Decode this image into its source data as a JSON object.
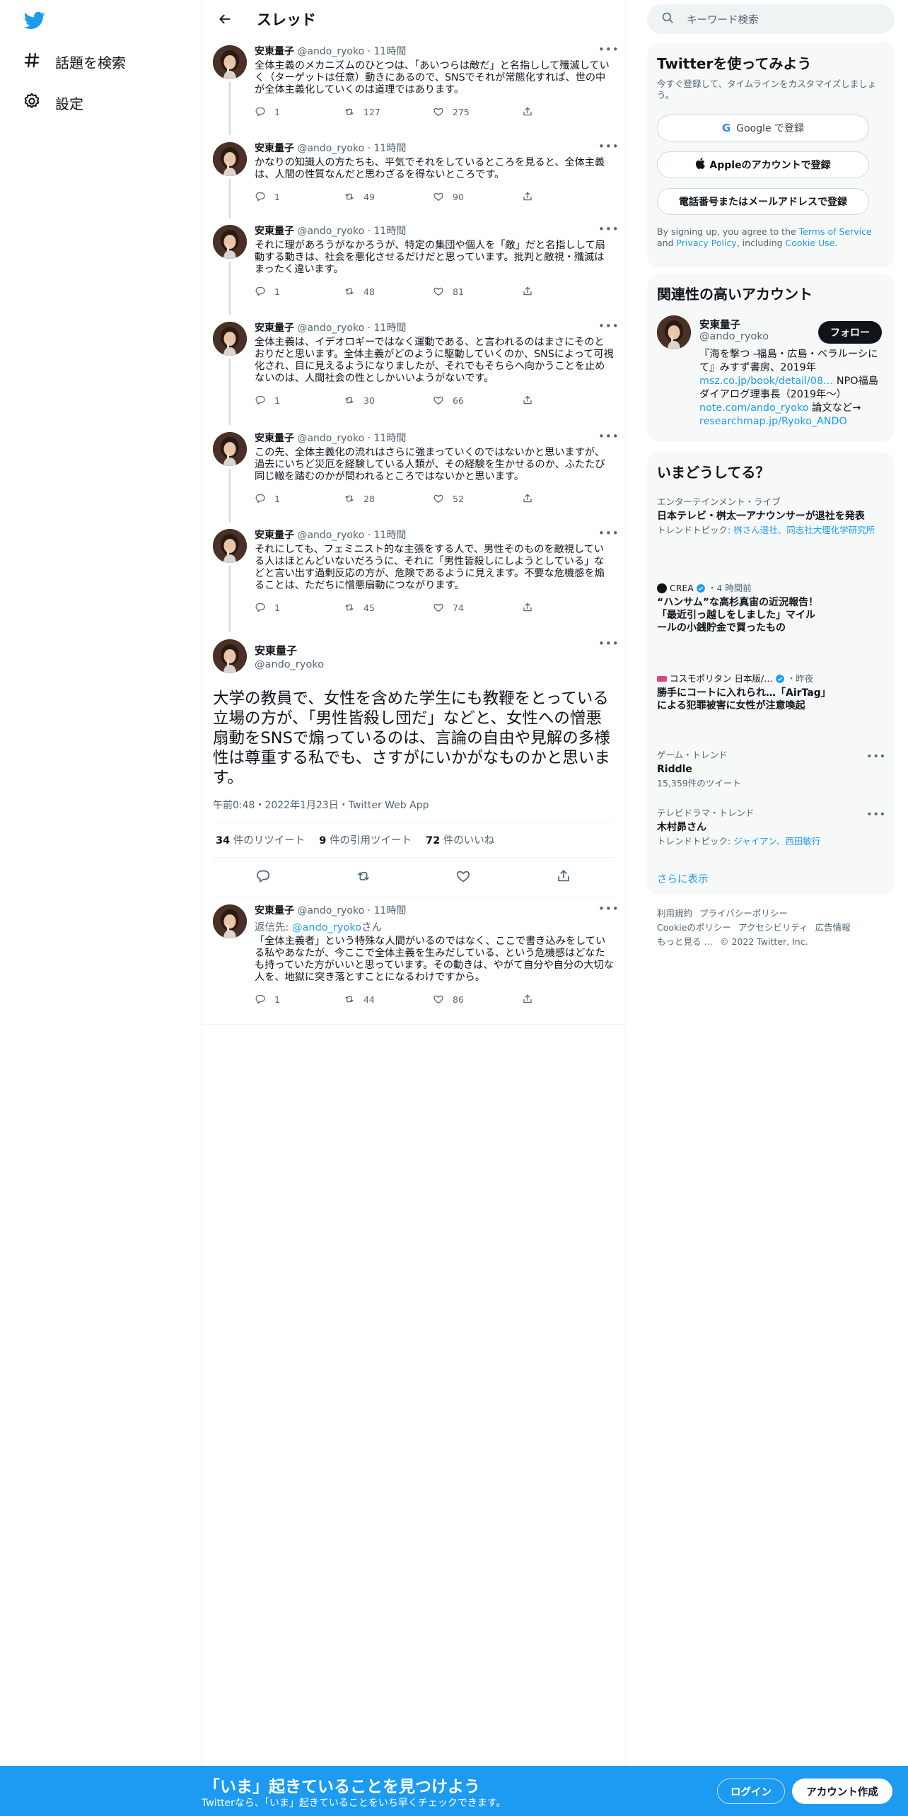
{
  "nav": {
    "explore_label": "話題を検索",
    "settings_label": "設定"
  },
  "header": {
    "title": "スレッド"
  },
  "thread_tweets": [
    {
      "name": "安東量子",
      "handle": "@ando_ryoko",
      "time": "11時間",
      "text": "全体主義のメカニズムのひとつは、「あいつらは敵だ」と名指しして殲滅していく（ターゲットは任意）動きにあるので、SNSでそれが常態化すれば、世の中が全体主義化していくのは道理ではあります。",
      "replies": "1",
      "retweets": "127",
      "likes": "275"
    },
    {
      "name": "安東量子",
      "handle": "@ando_ryoko",
      "time": "11時間",
      "text": "かなりの知識人の方たちも、平気でそれをしているところを見ると、全体主義は、人間の性質なんだと思わざるを得ないところです。",
      "replies": "1",
      "retweets": "49",
      "likes": "90"
    },
    {
      "name": "安東量子",
      "handle": "@ando_ryoko",
      "time": "11時間",
      "text": "それに理があろうがなかろうが、特定の集団や個人を「敵」だと名指しして扇動する動きは、社会を悪化させるだけだと思っています。批判と敵視・殲滅はまったく違います。",
      "replies": "1",
      "retweets": "48",
      "likes": "81"
    },
    {
      "name": "安東量子",
      "handle": "@ando_ryoko",
      "time": "11時間",
      "text": "全体主義は、イデオロギーではなく運動である、と言われるのはまさにそのとおりだと思います。全体主義がどのように駆動していくのか、SNSによって可視化され、目に見えるようになりましたが、それでもそちらへ向かうことを止めないのは、人間社会の性としかいいようがないです。",
      "replies": "1",
      "retweets": "30",
      "likes": "66"
    },
    {
      "name": "安東量子",
      "handle": "@ando_ryoko",
      "time": "11時間",
      "text": "この先、全体主義化の流れはさらに強まっていくのではないかと思いますが、過去にいちど災厄を経験している人類が、その経験を生かせるのか、ふたたび同じ轍を踏むのかが問われるところではないかと思います。",
      "replies": "1",
      "retweets": "28",
      "likes": "52"
    },
    {
      "name": "安東量子",
      "handle": "@ando_ryoko",
      "time": "11時間",
      "text": "それにしても、フェミニスト的な主張をする人で、男性そのものを敵視している人はほとんどいないだろうに、それに「男性皆殺しにしようとしている」などと言い出す過剰反応の方が、危険であるように見えます。不要な危機感を煽ることは、ただちに憎悪扇動につながります。",
      "replies": "1",
      "retweets": "45",
      "likes": "74"
    }
  ],
  "main_tweet": {
    "name": "安東量子",
    "handle": "@ando_ryoko",
    "text": "大学の教員で、女性を含めた学生にも教鞭をとっている立場の方が、「男性皆殺し団だ」などと、女性への憎悪扇動をSNSで煽っているのは、言論の自由や見解の多様性は尊重する私でも、さすがにいかがなものかと思います。",
    "timestamp": "午前0:48・2022年1月23日・Twitter Web App",
    "retweet_count": "34",
    "retweet_label": "件のリツイート",
    "quote_count": "9",
    "quote_label": "件の引用ツイート",
    "like_count": "72",
    "like_label": "件のいいね"
  },
  "reply_tweet": {
    "name": "安東量子",
    "handle": "@ando_ryoko",
    "time": "11時間",
    "reply_prefix": "返信先: ",
    "reply_target": "@ando_ryoko",
    "reply_suffix": "さん",
    "text": "「全体主義者」という特殊な人間がいるのではなく、ここで書き込みをしている私やあなたが、今ここで全体主義を生みだしている、という危機感はどなたも持っていた方がいいと思っています。その動きは、やがて自分や自分の大切な人を、地獄に突き落とすことになるわけですから。",
    "replies": "1",
    "retweets": "44",
    "likes": "86"
  },
  "search": {
    "placeholder": "キーワード検索"
  },
  "signup": {
    "title": "Twitterを使ってみよう",
    "subtitle": "今すぐ登録して、タイムラインをカスタマイズしましょう。",
    "google_label": "Google で登録",
    "apple_label": "Appleのアカウントで登録",
    "phone_label": "電話番号またはメールアドレスで登録",
    "tos_prefix": "By signing up, you agree to the ",
    "tos_terms": "Terms of Service",
    "tos_and": " and ",
    "tos_privacy": "Privacy Policy",
    "tos_including": ", including ",
    "tos_cookie": "Cookie Use",
    "tos_end": "."
  },
  "related": {
    "title": "関連性の高いアカウント",
    "name": "安東量子",
    "handle": "@ando_ryoko",
    "follow_label": "フォロー",
    "bio_1": "『海を撃つ -福島・広島・ベラルーシにて』みすず書房、2019年",
    "bio_link_1": "msz.co.jp/book/detail/08…",
    "bio_2": " NPO福島ダイアログ理事長（2019年〜）",
    "bio_link_2": "note.com/ando_ryoko",
    "bio_3": " 論文など→ ",
    "bio_link_3": "researchmap.jp/Ryoko_ANDO"
  },
  "trends": {
    "title": "いまどうしてる？",
    "items": [
      {
        "context": "エンターテインメント・ライブ",
        "title": "日本テレビ・桝太一アナウンサーが退社を発表",
        "topic_prefix": "トレンドトピック: ",
        "topic_links": "桝さん退社、同志社大理化学研究所"
      },
      {
        "publisher": "CREA",
        "time": "・4 時間前",
        "title": "“ハンサム”な高杉真宙の近況報告！「最近引っ越しをしました」マイルールの小銭貯金で買ったもの"
      },
      {
        "publisher": "コスモポリタン 日本版/…",
        "time": "・昨夜",
        "title": "勝手にコートに入れられ…「AirTag」による犯罪被害に女性が注意喚起"
      },
      {
        "context": "ゲーム・トレンド",
        "title": "Riddle",
        "count": "15,359件のツイート"
      },
      {
        "context": "テレビドラマ・トレンド",
        "title": "木村昴さん",
        "topic_prefix": "トレンドトピック: ",
        "topic_links": "ジャイアン、西田敏行"
      }
    ],
    "show_more": "さらに表示"
  },
  "footer": {
    "links": [
      "利用規約",
      "プライバシーポリシー",
      "Cookieのポリシー",
      "アクセシビリティ",
      "広告情報",
      "もっと見る …",
      "© 2022 Twitter, Inc."
    ]
  },
  "bottom_bar": {
    "title": "「いま」起きていることを見つけよう",
    "subtitle": "Twitterなら、「いま」起きていることをいち早くチェックできます。",
    "login_label": "ログイン",
    "signup_label": "アカウント作成"
  },
  "colors": {
    "brand": "#1d9bf0",
    "text": "#0f1419",
    "muted": "#536471",
    "card_bg": "#f7f9f9"
  },
  "icons": {
    "logo": "twitter-bird-icon",
    "explore": "hashtag-icon",
    "settings": "gear-icon",
    "back": "arrow-left-icon",
    "search": "search-icon"
  }
}
